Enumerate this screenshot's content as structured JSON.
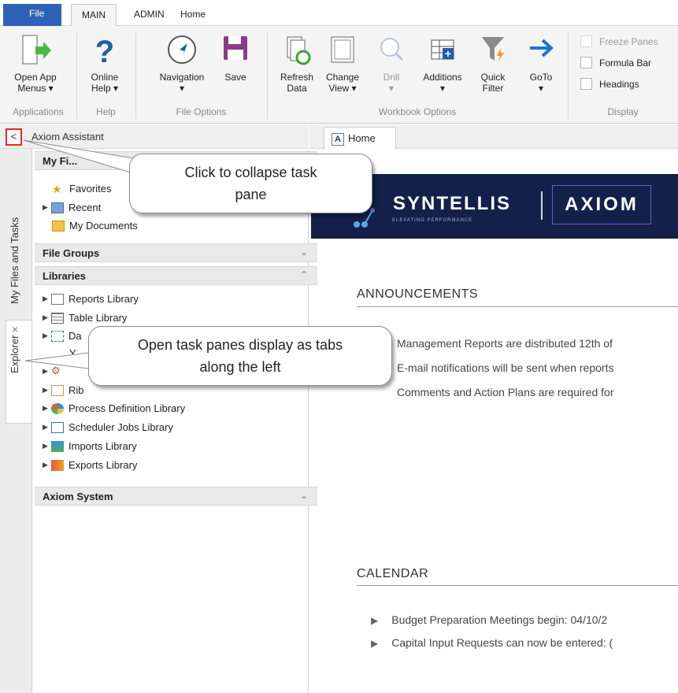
{
  "ribbon": {
    "tabs": [
      "File",
      "MAIN",
      "ADMIN",
      "Home"
    ],
    "groups": [
      "Applications",
      "Help",
      "File Options",
      "Workbook Options",
      "Display"
    ],
    "buttons": {
      "open_app_menus": [
        "Open App",
        "Menus ▾"
      ],
      "online_help": [
        "Online",
        "Help ▾"
      ],
      "navigation": [
        "Navigation",
        "▾"
      ],
      "save": "Save",
      "refresh_data": [
        "Refresh",
        "Data"
      ],
      "change_view": [
        "Change",
        "View ▾"
      ],
      "drill": [
        "Drill",
        "▾"
      ],
      "additions": [
        "Additions",
        "▾"
      ],
      "quick_filter": [
        "Quick",
        "Filter"
      ],
      "goto": [
        "GoTo",
        "▾"
      ]
    },
    "checkboxes": [
      "Freeze Panes",
      "Formula Bar",
      "Headings"
    ]
  },
  "side_tabs": [
    "My Files and Tasks",
    "Explorer"
  ],
  "side_tab_close": "×",
  "assistant": {
    "collapse_glyph": "<",
    "title": "Axiom Assistant",
    "my_files_header": "My Fi...",
    "my_files": [
      "Favorites",
      "Recent",
      "My Documents"
    ],
    "file_groups": "File Groups",
    "libraries": "Libraries",
    "library_items": [
      "Reports Library",
      "Table Library",
      "Da",
      "Y",
      "Rib",
      "Process Definition Library",
      "Scheduler Jobs Library",
      "Imports Library",
      "Exports Library"
    ],
    "axiom_system": "Axiom System",
    "chevron_down": "⌄",
    "chevron_up": "⌃"
  },
  "document": {
    "tab_label": "Home",
    "tab_icon_letter": "A",
    "brand_name": "SYNTELLIS",
    "brand_tagline": "ELEVATING PERFORMANCE",
    "brand_product": "AXIOM",
    "announcements_heading": "ANNOUNCEMENTS",
    "announcements": [
      "Management Reports are distributed 12th of",
      "E-mail notifications will be sent when reports",
      "Comments and Action Plans are required for"
    ],
    "calendar_heading": "CALENDAR",
    "calendar": [
      "Budget Preparation Meetings begin: 04/10/2",
      "Capital Input Requests can now be entered: ("
    ]
  },
  "callouts": {
    "collapse": [
      "Click to collapse task",
      "pane"
    ],
    "tabs": [
      "Open task panes display as tabs",
      "along the left"
    ]
  }
}
